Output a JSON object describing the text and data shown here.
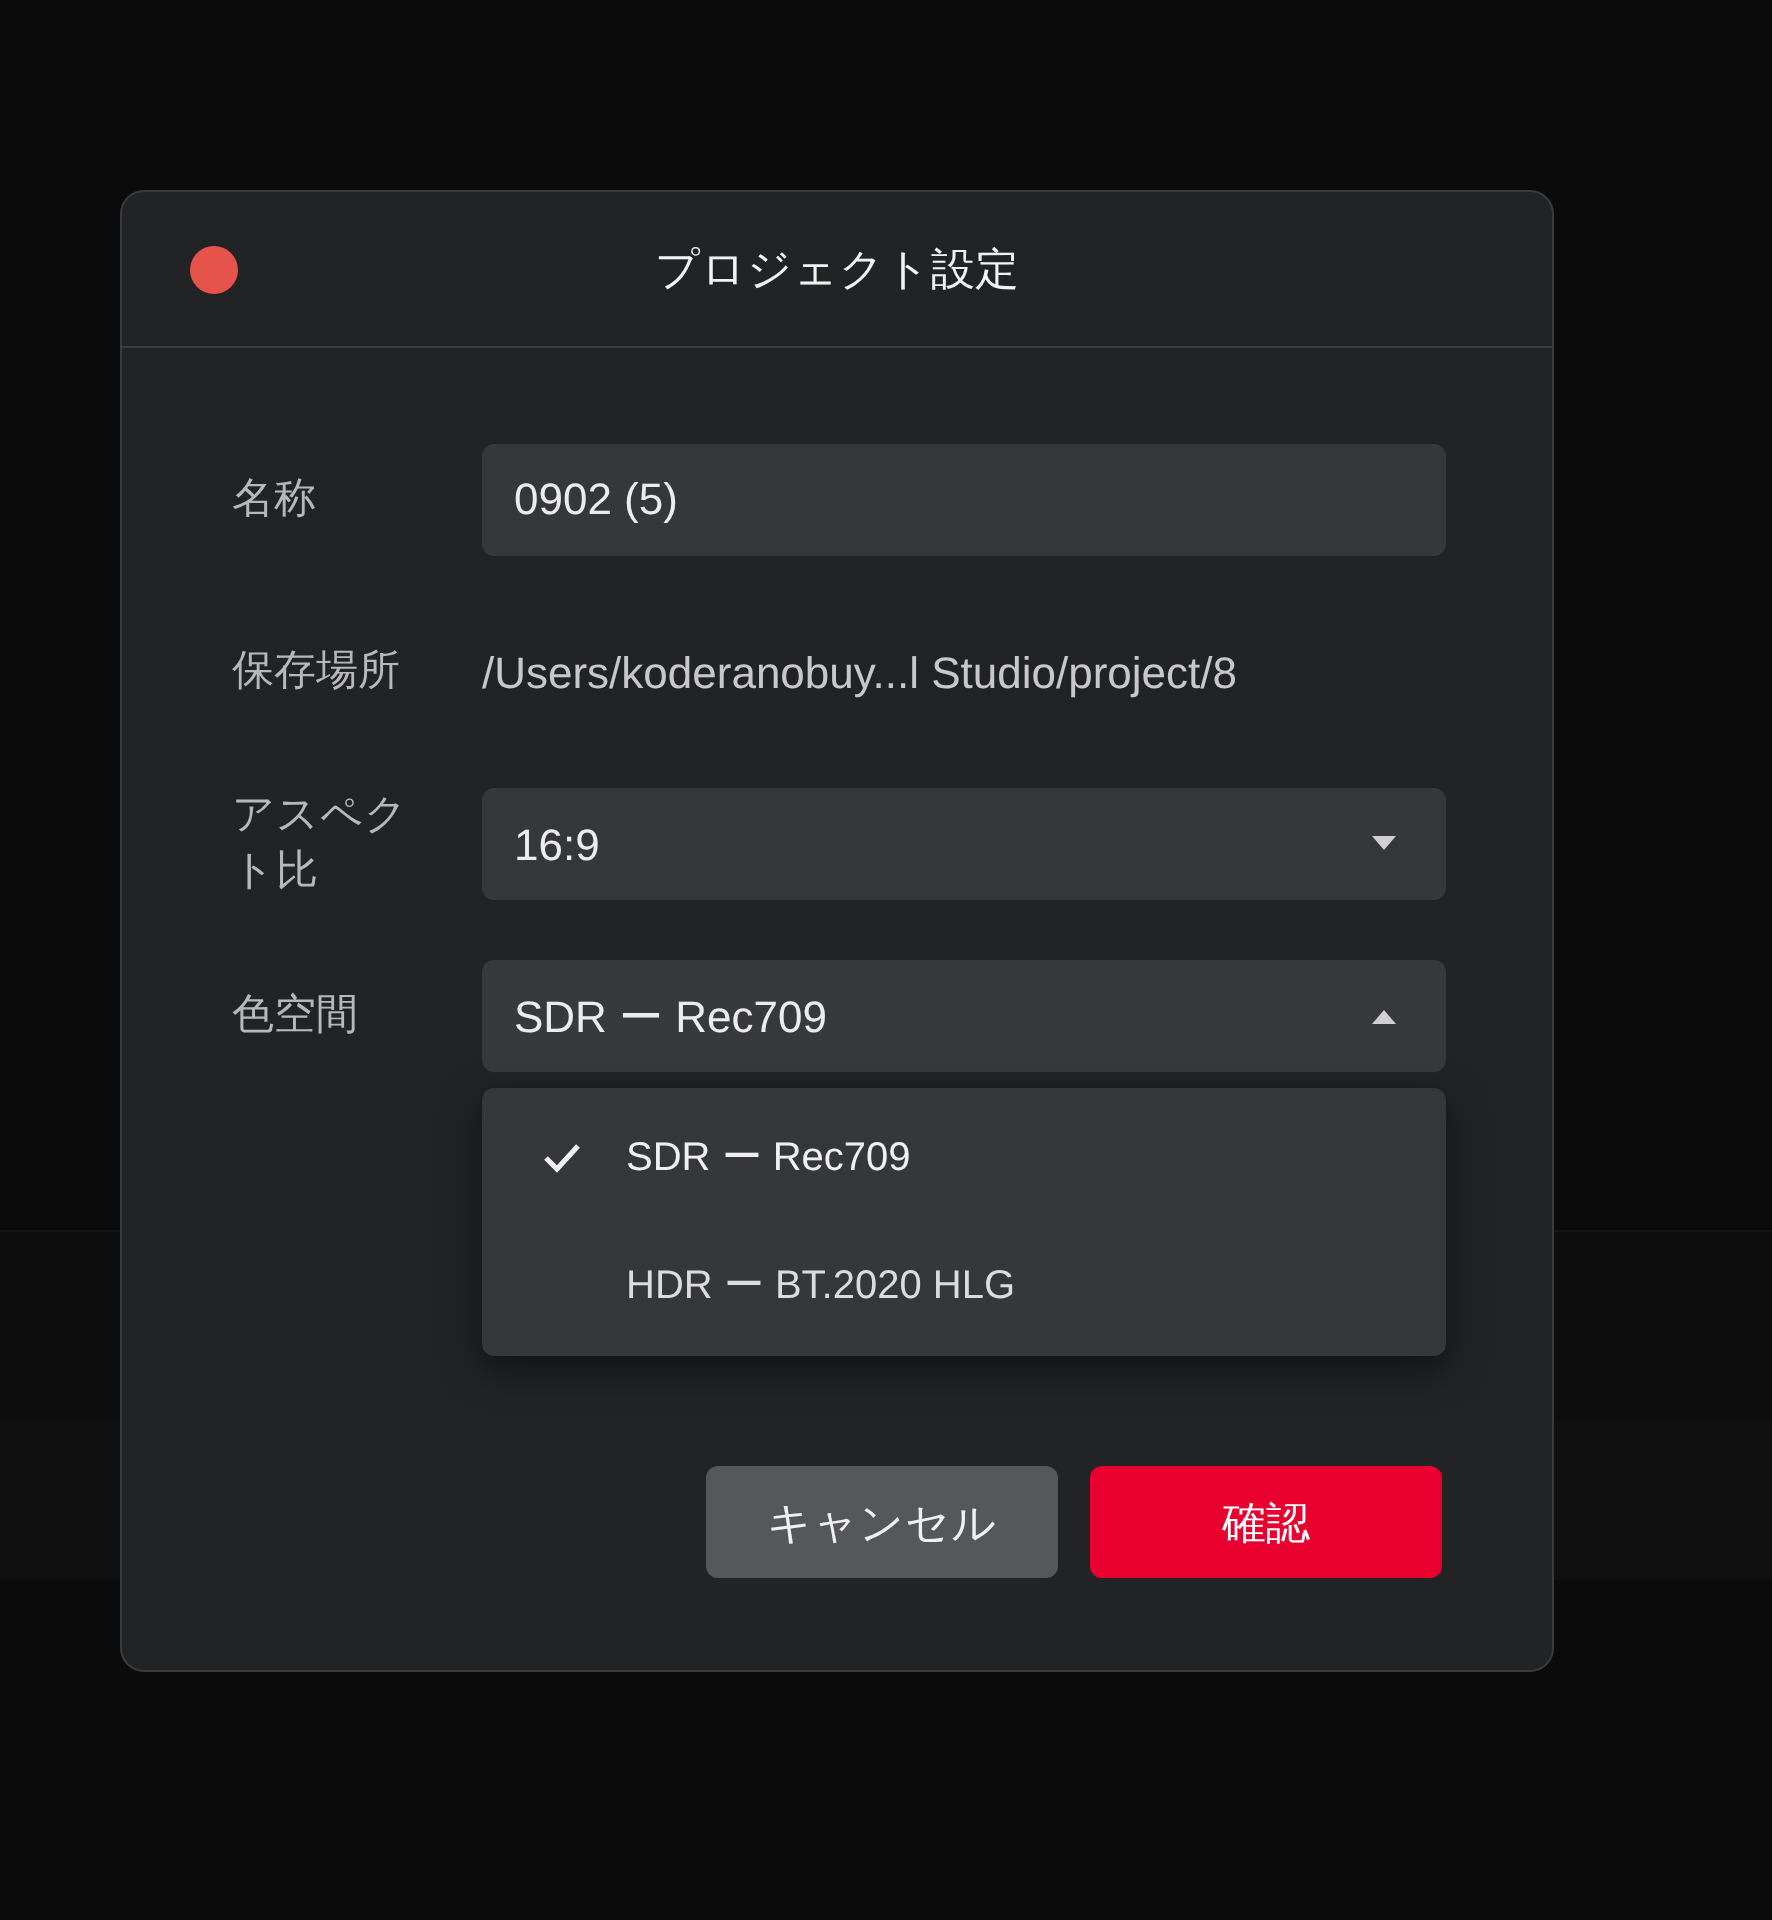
{
  "dialog": {
    "title": "プロジェクト設定",
    "fields": [
      {
        "kind": "text",
        "label": "名称",
        "value": "0902 (5)"
      },
      {
        "kind": "static",
        "label": "保存場所",
        "value": "/Users/koderanobuy...l Studio/project/8"
      },
      {
        "kind": "select",
        "label": "アスペクト比",
        "value": "16:9",
        "expanded": false
      },
      {
        "kind": "select",
        "label": "色空間",
        "value": "SDR ー Rec709",
        "expanded": true,
        "options": [
          {
            "label": "SDR ー Rec709",
            "selected": true
          },
          {
            "label": "HDR ー BT.2020 HLG",
            "selected": false
          }
        ]
      }
    ],
    "buttons": [
      {
        "kind": "secondary",
        "label": "キャンセル"
      },
      {
        "kind": "primary",
        "label": "確認"
      }
    ]
  }
}
